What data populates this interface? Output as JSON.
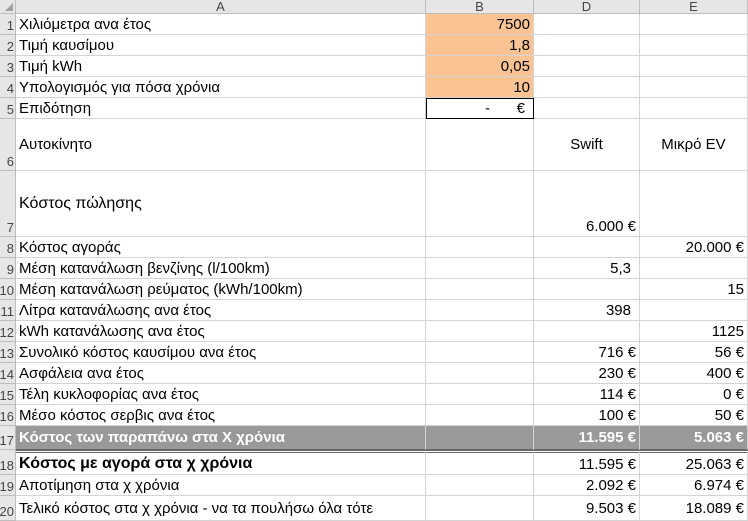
{
  "columns": {
    "a": "A",
    "b": "B",
    "d": "D",
    "e": "E"
  },
  "rows": {
    "r1": {
      "num": "1",
      "label": "Χιλιόμετρα ανα έτος",
      "b": "7500"
    },
    "r2": {
      "num": "2",
      "label": "Τιμή καυσίμου",
      "b": "1,8"
    },
    "r3": {
      "num": "3",
      "label": "Τιμή kWh",
      "b": "0,05"
    },
    "r4": {
      "num": "4",
      "label": "Υπολογισμός για πόσα χρόνια",
      "b": "10"
    },
    "r5": {
      "num": "5",
      "label": "Επιδότηση",
      "b_dash": "-",
      "b_cur": "€"
    },
    "r6": {
      "num": "6",
      "label": "Αυτοκίνητο",
      "d": "Swift",
      "e": "Μικρό EV"
    },
    "r7": {
      "num": "7",
      "label": "Κόστος πώλησης",
      "d": "6.000 €"
    },
    "r8": {
      "num": "8",
      "label": "Κόστος αγοράς",
      "e": "20.000 €"
    },
    "r9": {
      "num": "9",
      "label": "Μέση κατανάλωση βενζίνης (l/100km)",
      "d": "5,3"
    },
    "r10": {
      "num": "10",
      "label": "Μέση κατανάλωση ρεύματος (kWh/100km)",
      "e": "15"
    },
    "r11": {
      "num": "11",
      "label": "Λίτρα κατανάλωσης ανα έτος",
      "d": "398"
    },
    "r12": {
      "num": "12",
      "label": "kWh κατανάλωσης ανα έτος",
      "e": "1125"
    },
    "r13": {
      "num": "13",
      "label": "Συνολικό κόστος καυσίμου ανα έτος",
      "d": "716 €",
      "e": "56 €"
    },
    "r14": {
      "num": "14",
      "label": "Ασφάλεια ανα έτος",
      "d": "230 €",
      "e": "400 €"
    },
    "r15": {
      "num": "15",
      "label": "Τέλη κυκλοφορίας ανα έτος",
      "d": "114 €",
      "e": "0 €"
    },
    "r16": {
      "num": "16",
      "label": "Μέσο κόστος σερβις ανα έτος",
      "d": "100 €",
      "e": "50 €"
    },
    "r17": {
      "num": "17",
      "label": "Κόστος των παραπάνω στα Χ χρόνια",
      "d": "11.595 €",
      "e": "5.063 €"
    },
    "r18": {
      "num": "18",
      "label": "Κόστος με αγορά στα χ χρόνια",
      "d": "11.595 €",
      "e": "25.063 €"
    },
    "r19": {
      "num": "19",
      "label": "Αποτίμηση στα χ χρόνια",
      "d": "2.092 €",
      "e": "6.974 €"
    },
    "r20": {
      "num": "20",
      "label": "Τελικό κόστος στα χ χρόνια - να τα πουλήσω όλα τότε",
      "d": "9.503 €",
      "e": "18.089 €"
    }
  },
  "colors": {
    "input_fill": "#f9c394",
    "total_row_fill": "#999999",
    "header_fill": "#e6e6e6"
  }
}
